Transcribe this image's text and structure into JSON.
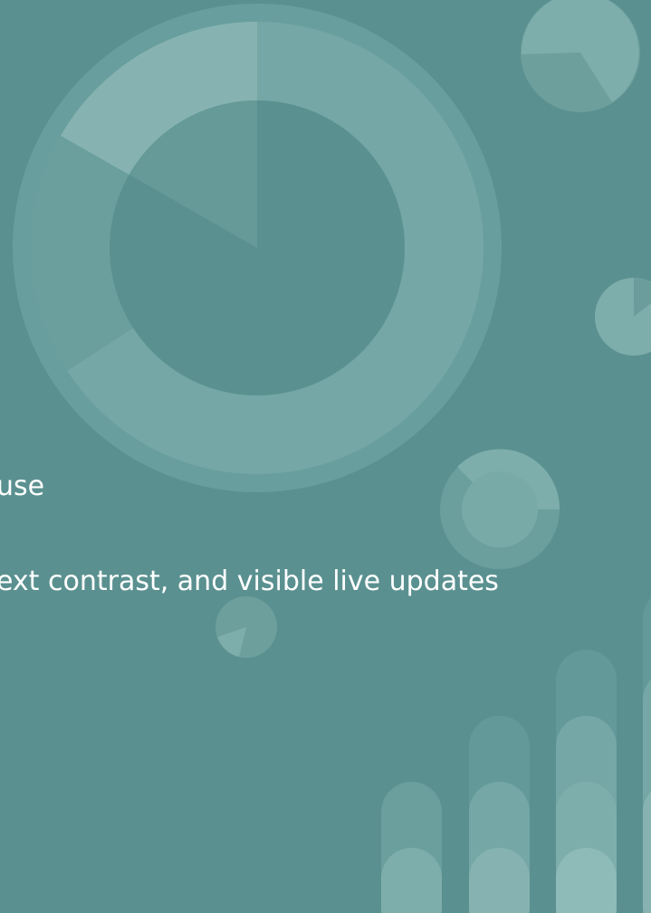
{
  "colors": {
    "background": "#5a9190",
    "text": "#ffffff",
    "decor_light": "#a6c8c6",
    "decor_mid": "#7eaeac"
  },
  "text": {
    "line1": "use",
    "line2": "ext contrast, and visible live updates"
  }
}
